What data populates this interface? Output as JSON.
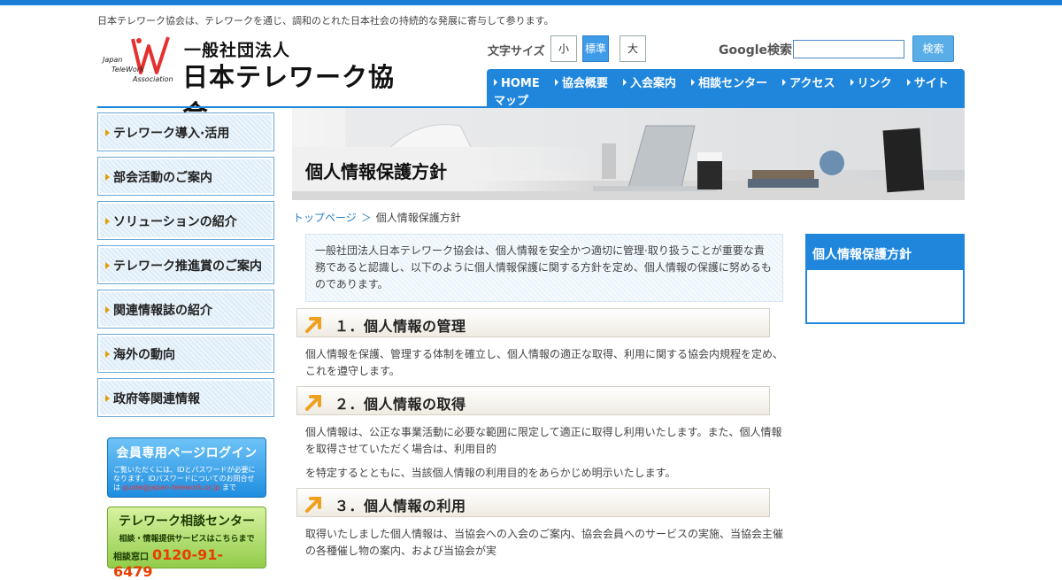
{
  "header": {
    "tagline": "日本テレワーク協会は、テレワークを通じ、調和のとれた日本社会の持続的な発展に寄与して参ります。",
    "logo": {
      "line1": "一般社団法人",
      "line2": "日本テレワーク協会",
      "mark_text": [
        "Japan",
        "TeleWork",
        "Association"
      ]
    },
    "font_size": {
      "label": "文字サイズ",
      "options": [
        "小",
        "標準",
        "大"
      ],
      "selected": "標準"
    },
    "search": {
      "label": "Google検索",
      "value": "",
      "button": "検索"
    }
  },
  "nav": {
    "items": [
      "HOME",
      "協会概要",
      "入会案内",
      "相談センター",
      "アクセス",
      "リンク",
      "サイトマップ"
    ]
  },
  "sidebar": {
    "items": [
      "テレワーク導入·活用",
      "部会活動のご案内",
      "ソリューションの紹介",
      "テレワーク推進賞のご案内",
      "関連情報誌の紹介",
      "海外の動向",
      "政府等関連情報"
    ],
    "promo_login": {
      "title": "会員専用ページログイン",
      "text1": "ご覧いただくには、IDとパスワードが必要になります。IDパスワードについてのお問合せは",
      "email": "guide@japan-telework.or.jp",
      "text2": "まで"
    },
    "promo_consult": {
      "title": "テレワーク相談センター",
      "sub": "相談・情報提供サービスはこちらまで",
      "phone_label": "相談窓口",
      "phone": "0120-91-6479"
    }
  },
  "banner": {
    "title": "個人情報保護方針"
  },
  "breadcrumb": {
    "home": "トップページ",
    "sep": "＞",
    "current": "個人情報保護方針"
  },
  "content": {
    "intro": "一般社団法人日本テレワーク協会は、個人情報を安全かつ適切に管理·取り扱うことが重要な責務であると認識し、以下のように個人情報保護に関する方針を定め、個人情報の保護に努めるものであります。",
    "sections": [
      {
        "title": "１．個人情報の管理",
        "paragraphs": [
          "個人情報を保護、管理する体制を確立し、個人情報の適正な取得、利用に関する協会内規程を定め、これを遵守します。"
        ]
      },
      {
        "title": "２．個人情報の取得",
        "paragraphs": [
          "個人情報は、公正な事業活動に必要な範囲に限定して適正に取得し利用いたします。また、個人情報を取得させていただく場合は、利用目的",
          "を特定するとともに、当該個人情報の利用目的をあらかじめ明示いたします。"
        ]
      },
      {
        "title": "３．個人情報の利用",
        "paragraphs": [
          "取得いたしました個人情報は、当協会への入会のご案内、協会会員へのサービスの実施、当協会主催の各種催し物の案内、および当協会が実"
        ]
      }
    ]
  },
  "right_box": {
    "title": "個人情報保護方針"
  },
  "colors": {
    "brand_blue": "#1f86dc",
    "accent_orange": "#f0a020",
    "promo_green": "#92cc4a"
  }
}
